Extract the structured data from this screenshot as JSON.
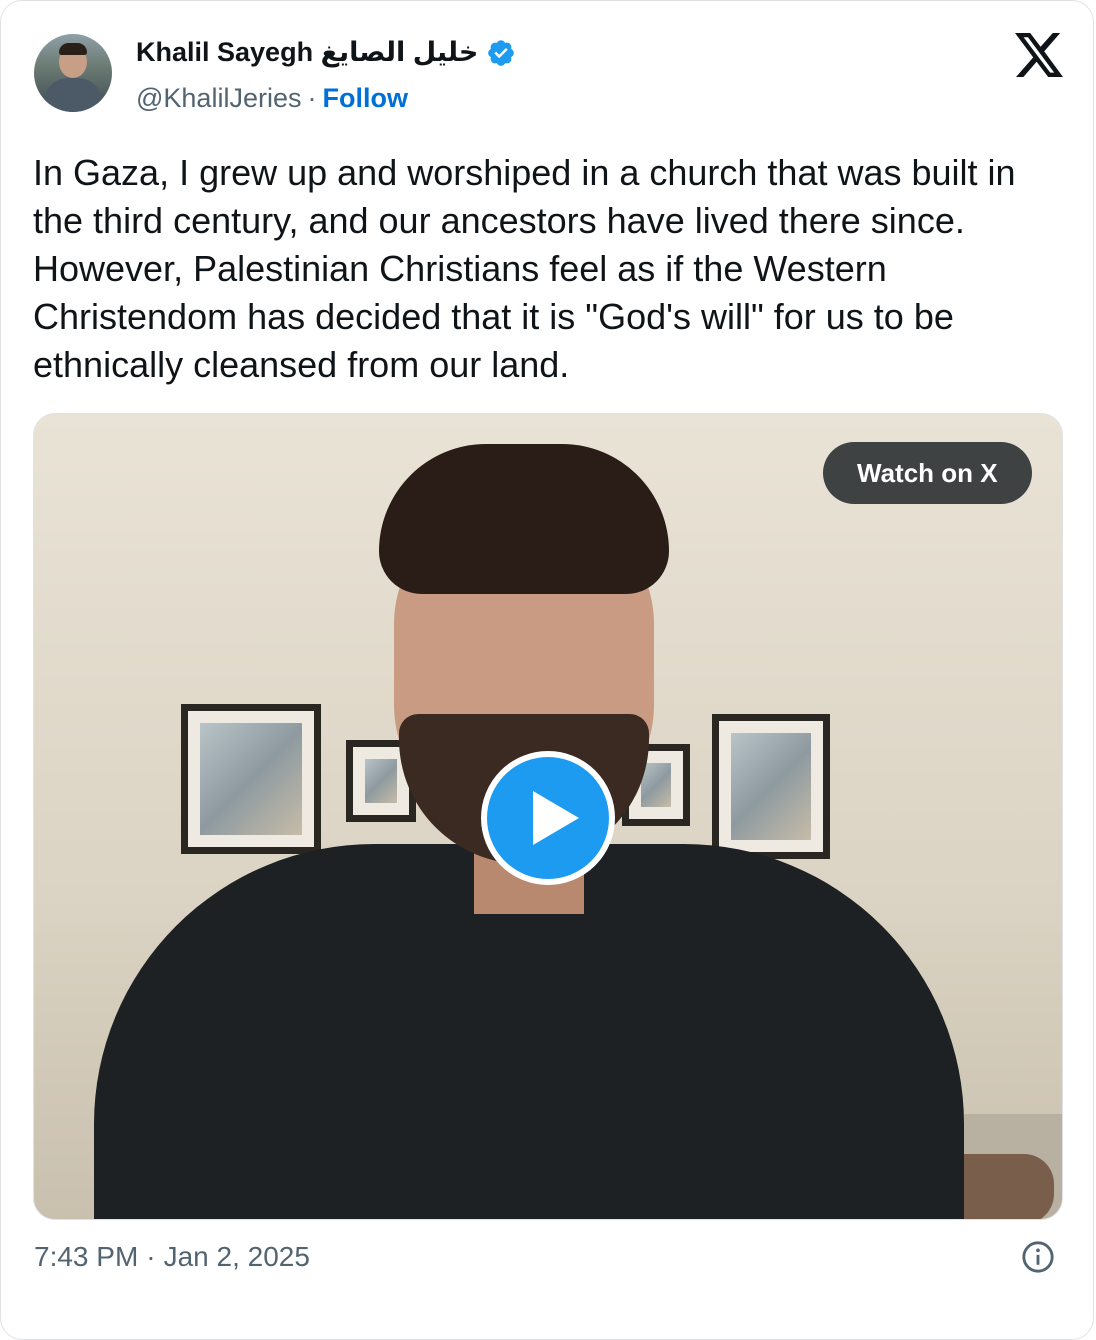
{
  "author": {
    "name": "Khalil Sayegh خليل الصايغ",
    "handle": "@KhalilJeries",
    "separator": "·",
    "follow_label": "Follow",
    "verified_icon": "verified-badge-icon"
  },
  "platform": {
    "logo_icon": "x-logo-icon"
  },
  "tweet": {
    "text": "In Gaza, I grew up and worshiped in a church that was built in the third century, and our ancestors have lived there since. However, Palestinian Christians feel as if the Western Christendom has decided that it is \"God's will\" for us to be ethnically cleansed from our land."
  },
  "media": {
    "watch_label": "Watch on X",
    "play_icon": "play-icon"
  },
  "footer": {
    "time": "7:43 PM",
    "separator": "·",
    "date": "Jan 2, 2025",
    "info_icon": "info-icon"
  },
  "colors": {
    "link_blue": "#006fd6",
    "verified_blue": "#1d9bf0",
    "text_primary": "#0f1419",
    "text_secondary": "#536471"
  }
}
